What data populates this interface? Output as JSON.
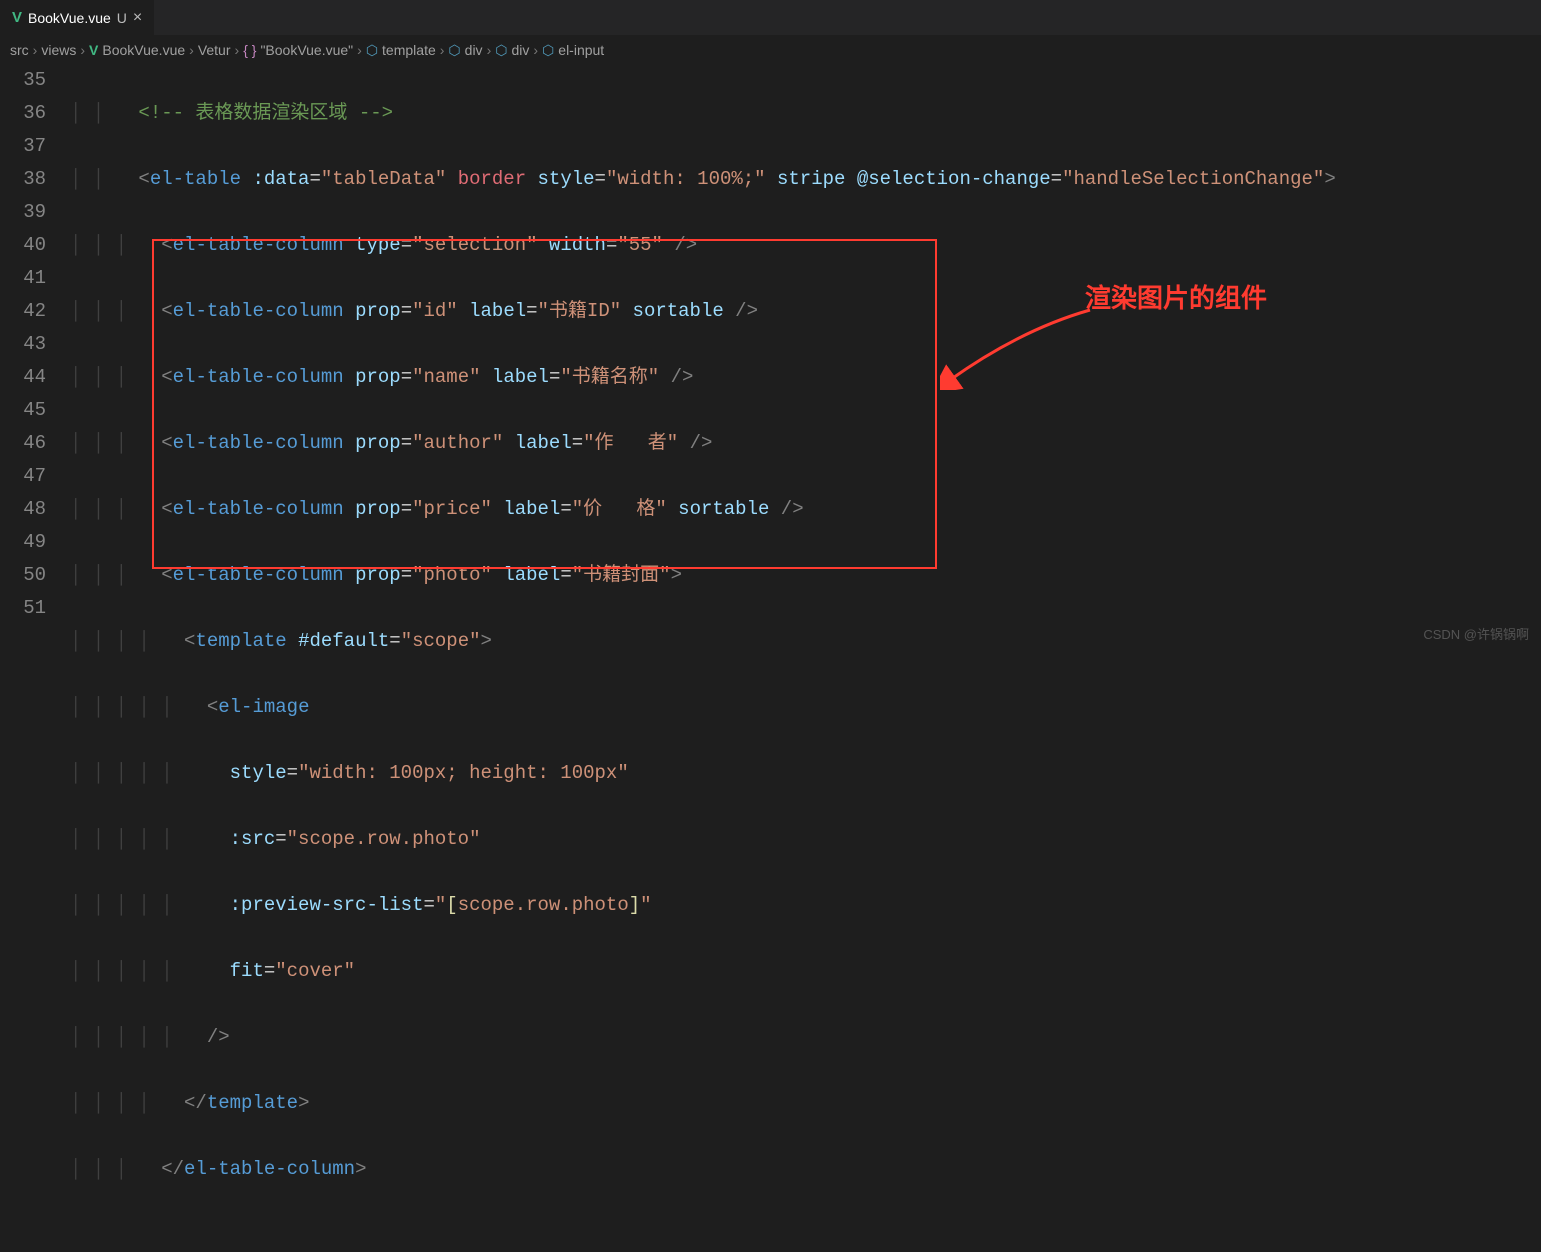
{
  "tab": {
    "icon": "V",
    "name": "BookVue.vue",
    "modified": "U",
    "close": "×"
  },
  "breadcrumb": {
    "items": [
      "src",
      "views",
      "BookVue.vue",
      "Vetur",
      "\"BookVue.vue\"",
      "template",
      "div",
      "div",
      "el-input"
    ]
  },
  "annotation": "渲染图片的组件",
  "watermark": "CSDN @许锅锅啊",
  "line_numbers": [
    "35",
    "36",
    "37",
    "38",
    "39",
    "40",
    "41",
    "42",
    "43",
    "44",
    "45",
    "46",
    "47",
    "48",
    "49",
    "50",
    "51"
  ],
  "code": {
    "l35_comment": "<!-- 表格数据渲染区域 -->",
    "l36": {
      "tag": "el-table",
      "a1": ":data",
      "v1": "\"tableData\"",
      "a2": "border",
      "a3": "style",
      "v3": "\"width: 100%;\"",
      "a4": "stripe",
      "a5": "@selection-change",
      "v5": "\"handleSelectionChange\""
    },
    "l37": {
      "tag": "el-table-column",
      "a1": "type",
      "v1": "\"selection\"",
      "a2": "width",
      "v2": "\"55\""
    },
    "l38": {
      "tag": "el-table-column",
      "a1": "prop",
      "v1": "\"id\"",
      "a2": "label",
      "v2": "\"书籍ID\"",
      "a3": "sortable"
    },
    "l39": {
      "tag": "el-table-column",
      "a1": "prop",
      "v1": "\"name\"",
      "a2": "label",
      "v2": "\"书籍名称\""
    },
    "l40": {
      "tag": "el-table-column",
      "a1": "prop",
      "v1": "\"author\"",
      "a2": "label",
      "v2": "\"作   者\""
    },
    "l41": {
      "tag": "el-table-column",
      "a1": "prop",
      "v1": "\"price\"",
      "a2": "label",
      "v2": "\"价   格\"",
      "a3": "sortable"
    },
    "l42": {
      "tag": "el-table-column",
      "a1": "prop",
      "v1": "\"photo\"",
      "a2": "label",
      "v2": "\"书籍封面\""
    },
    "l43": {
      "tag": "template",
      "a1": "#default",
      "v1": "\"scope\""
    },
    "l44": {
      "tag": "el-image"
    },
    "l45": {
      "a": "style",
      "v": "\"width: 100px; height: 100px\""
    },
    "l46": {
      "a": ":src",
      "v": "\"scope.row.photo\""
    },
    "l47": {
      "a": ":preview-src-list",
      "v": "\"[scope.row.photo]\"",
      "lb": "[",
      "mid": "scope.row.photo",
      "rb": "]"
    },
    "l48": {
      "a": "fit",
      "v": "\"cover\""
    },
    "l50": {
      "tag": "template"
    },
    "l51": {
      "tag": "el-table-column"
    }
  }
}
